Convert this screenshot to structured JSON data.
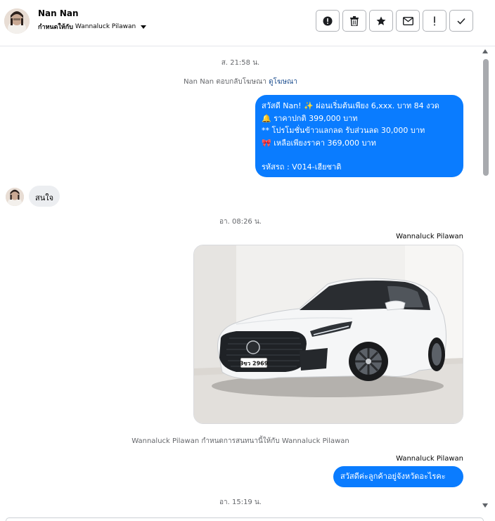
{
  "header": {
    "name": "Nan Nan",
    "assigned_prefix": "กำหนดให้กับ",
    "assigned_to": "Wannaluck Pilawan",
    "actions": [
      {
        "icon": "alert-circle-icon"
      },
      {
        "icon": "trash-icon"
      },
      {
        "icon": "star-icon"
      },
      {
        "icon": "envelope-icon"
      },
      {
        "icon": "exclamation-icon"
      },
      {
        "icon": "checkmark-icon"
      }
    ]
  },
  "messages": {
    "time1": "ส. 21:58 น.",
    "ad_reply_text": "Nan Nan ตอบกลับโฆษณา",
    "ad_reply_link": "ดูโฆษณา",
    "promo": {
      "line1": "สวัสดี Nan! ✨  ผ่อนเริ่มต้นเพียง 6,xxx. บาท 84 งวด",
      "line2": "🔔 ราคาปกติ 399,000 บาท",
      "line3": "** โปรโมชั่นข้าวแลกลด รับส่วนลด 30,000 บาท",
      "line4": "🎀  เหลือเพียงราคา 369,000 บาท",
      "line5": " รหัสรถ : V014-เฮียชาติ"
    },
    "incoming_reply": "สนใจ",
    "time2": "อา. 08:26 น.",
    "sender1": "Wannaluck Pilawan",
    "car_plate": "3ขว 2969",
    "assign_notice": "Wannaluck Pilawan กำหนดการสนทนานี้ให้กับ Wannaluck Pilawan",
    "sender2": "Wannaluck Pilawan",
    "outgoing_reply": "สวัสดีค่ะลูกค้าอยู่จังหวัดอะไรคะ",
    "time3": "อา. 15:19 น."
  },
  "colors": {
    "outgoing_bubble": "#0a7cff",
    "incoming_bubble": "#eceef1",
    "link": "#1d4e8f"
  }
}
